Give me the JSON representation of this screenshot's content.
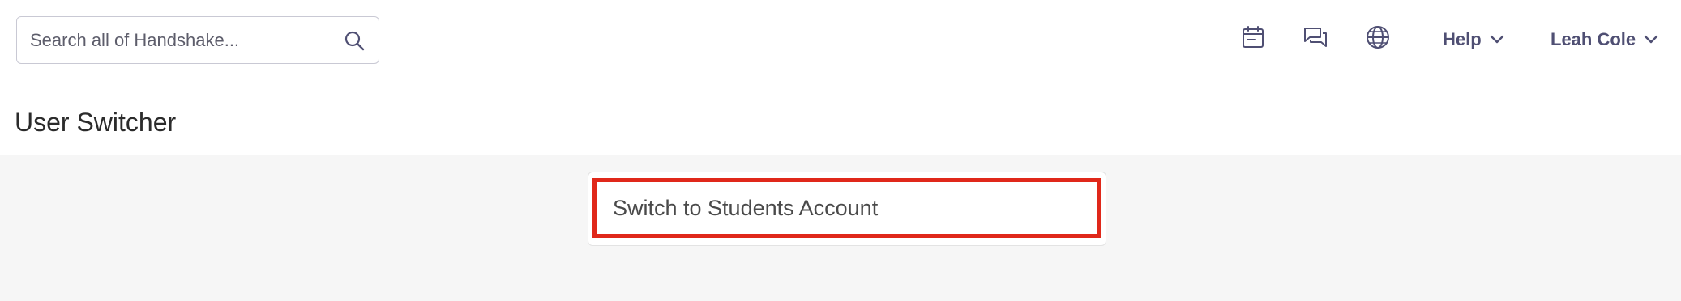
{
  "search": {
    "placeholder": "Search all of Handshake...",
    "value": ""
  },
  "topnav": {
    "icons": {
      "calendar": "calendar-icon",
      "messages": "messages-icon",
      "language": "globe-icon"
    },
    "help_label": "Help",
    "user_label": "Leah Cole"
  },
  "page": {
    "title": "User Switcher"
  },
  "switcher": {
    "link_label": "Switch to Students Account",
    "highlight_color": "#e0281a"
  },
  "colors": {
    "nav_text": "#4f4f73",
    "background": "#f6f6f6"
  }
}
